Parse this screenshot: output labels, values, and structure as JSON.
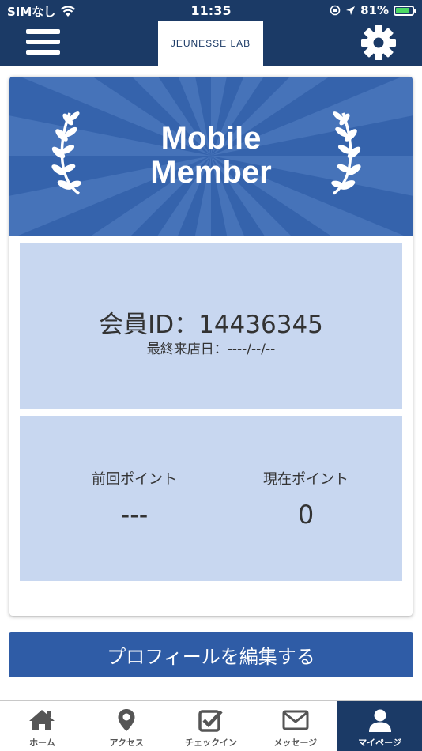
{
  "status_bar": {
    "carrier": "SIMなし",
    "time": "11:35",
    "battery": "81%"
  },
  "header": {
    "logo_text": "JEUNESSE LAB"
  },
  "card": {
    "banner": {
      "title_line1": "Mobile",
      "title_line2": "Member"
    },
    "member_id": "会員ID：14436345",
    "last_visit": "最終来店日：----/--/--",
    "points": {
      "previous_label": "前回ポイント",
      "previous_value": "---",
      "current_label": "現在ポイント",
      "current_value": "0"
    }
  },
  "profile_button": {
    "label": "プロフィールを編集する"
  },
  "tabbar": {
    "items": [
      {
        "label": "ホーム",
        "icon": "home-icon"
      },
      {
        "label": "アクセス",
        "icon": "map-pin-icon"
      },
      {
        "label": "チェックイン",
        "icon": "checkin-icon"
      },
      {
        "label": "メッセージ",
        "icon": "envelope-icon"
      },
      {
        "label": "マイページ",
        "icon": "user-icon"
      }
    ],
    "active_index": 4
  },
  "colors": {
    "header": "#1b3a66",
    "banner": "#3563ac",
    "panel": "#c8d7f0",
    "button": "#2f5ca6"
  }
}
